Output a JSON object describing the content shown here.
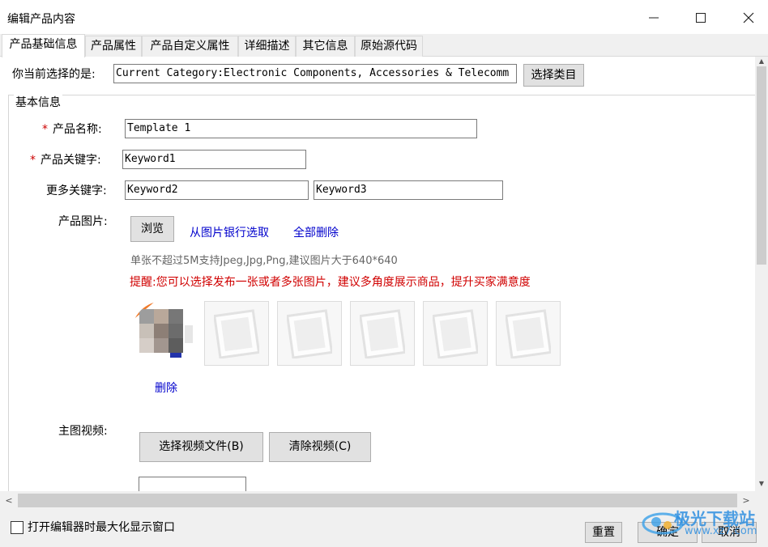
{
  "window": {
    "title": "编辑产品内容",
    "minimize_icon": "minimize-icon",
    "maximize_icon": "maximize-icon",
    "close_icon": "close-icon"
  },
  "tabs": [
    {
      "label": "产品基础信息",
      "active": true
    },
    {
      "label": "产品属性",
      "active": false
    },
    {
      "label": "产品自定义属性",
      "active": false
    },
    {
      "label": "详细描述",
      "active": false
    },
    {
      "label": "其它信息",
      "active": false
    },
    {
      "label": "原始源代码",
      "active": false
    }
  ],
  "category": {
    "label": "你当前选择的是:",
    "value": "Current Category:Electronic Components, Accessories & Telecomm",
    "select_button": "选择类目"
  },
  "basic_info": {
    "legend": "基本信息",
    "required_mark": "*",
    "product_name_label": "产品名称:",
    "product_name_value": "Template 1",
    "keyword_label": "产品关键字:",
    "keyword_value": "Keyword1",
    "more_keywords_label": "更多关键字:",
    "more_keyword_1": "Keyword2",
    "more_keyword_2": "Keyword3",
    "images_label": "产品图片:",
    "browse_button": "浏览",
    "from_bank_link": "从图片银行选取",
    "delete_all_link": "全部删除",
    "image_hint": "单张不超过5M支持Jpeg,Jpg,Png,建议图片大于640*640",
    "image_tip": "提醒:您可以选择发布一张或者多张图片，建议多角度展示商品，提升买家满意度",
    "delete_image_link": "删除",
    "video_label": "主图视频:",
    "select_video_button": "选择视频文件(B)",
    "clear_video_button": "清除视频(C)"
  },
  "footer": {
    "maximize_checkbox_label": "打开编辑器时最大化显示窗口",
    "maximize_checked": false,
    "reset_button": "重置",
    "ok_button": "确定",
    "cancel_button": "取消"
  },
  "watermark": {
    "text": "极光下载站",
    "url": "www.xz7.com"
  },
  "colors": {
    "link": "#0000cc",
    "required": "#cc0000",
    "warning": "#d00000"
  }
}
